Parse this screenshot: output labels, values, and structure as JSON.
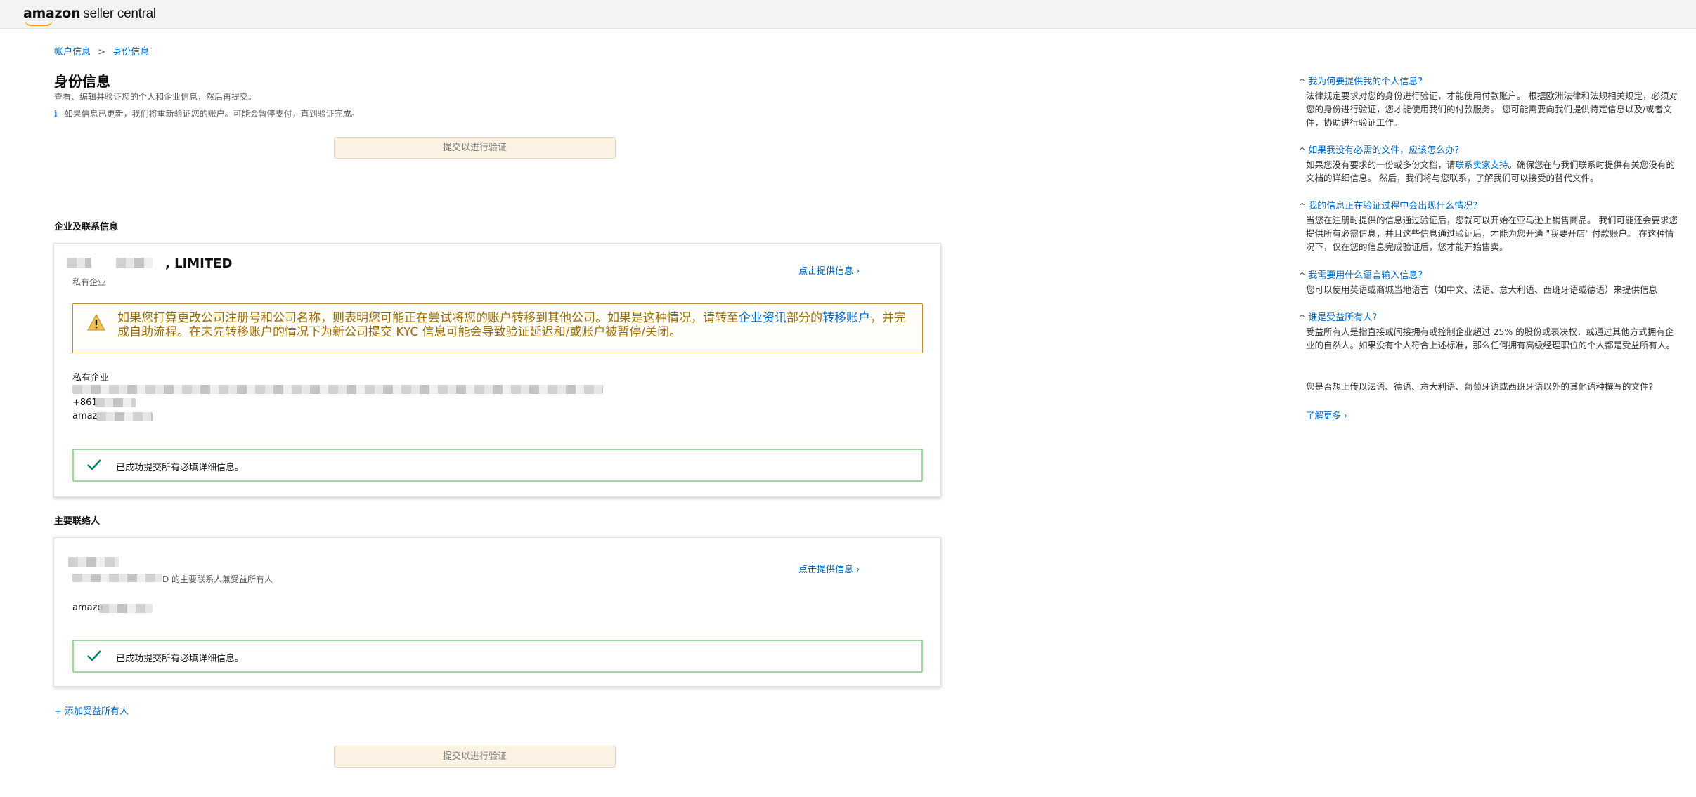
{
  "header": {
    "logo_amazon": "amazon",
    "logo_rest": "seller central"
  },
  "breadcrumb": {
    "parent": "帐户信息",
    "separator": ">",
    "current": "身份信息"
  },
  "page": {
    "title": "身份信息",
    "subtitle": "查看、编辑并验证您的个人和企业信息，然后再提交。",
    "info_icon": "i",
    "info_text": "如果信息已更新，我们将重新验证您的账户。可能会暂停支付，直到验证完成。",
    "submit_label": "提交以进行验证"
  },
  "business_section": {
    "heading": "企业及联系信息",
    "company_name_suffix": ", LIMITED",
    "company_type": "私有企业",
    "provide_link": "点击提供信息 ›",
    "warning": {
      "text_1": "如果您打算更改公司注册号和公司名称，则表明您可能正在尝试将您的账户转移到其他公司。如果是这种情况，请转至",
      "link_1": "企业资讯",
      "text_2": "部分的",
      "link_2": "转移账户",
      "text_3": "，并完成自助流程。在未先转移账户的情况下为新公司提交 KYC 信息可能会导致验证延迟和/或账户被暂停/关闭。"
    },
    "detail_type": "私有企业",
    "detail_phone_prefix": "+861",
    "detail_email_prefix": "amaz",
    "success_message": "已成功提交所有必填详细信息。"
  },
  "contact_section": {
    "heading": "主要联络人",
    "role_text": "D 的主要联系人兼受益所有人",
    "provide_link": "点击提供信息 ›",
    "email_prefix": "amazo",
    "success_message": "已成功提交所有必填详细信息。"
  },
  "add_owner_link": "+ 添加受益所有人",
  "colors": {
    "link": "#0066c0",
    "warning_border": "#b8912e",
    "warning_text": "#9a6d00",
    "success_border": "#9fd99b",
    "check": "#067d62",
    "submit_bg": "#fbf2e3"
  },
  "faq": [
    {
      "question": "我为何要提供我的个人信息?",
      "answer": "法律规定要求对您的身份进行验证，才能使用付款账户。 根据欧洲法律和法规相关规定，必须对您的身份进行验证，您才能使用我们的付款服务。 您可能需要向我们提供特定信息以及/或者文件，协助进行验证工作。"
    },
    {
      "question": "如果我没有必需的文件，应该怎么办?",
      "answer_1": "如果您没有要求的一份或多份文档，请",
      "answer_link": "联系卖家支持",
      "answer_2": "。确保您在与我们联系时提供有关您没有的文档的详细信息。 然后，我们将与您联系，了解我们可以接受的替代文件。"
    },
    {
      "question": "我的信息正在验证过程中会出现什么情况?",
      "answer": "当您在注册时提供的信息通过验证后，您就可以开始在亚马逊上销售商品。 我们可能还会要求您提供所有必需信息，并且这些信息通过验证后，才能为您开通 \"我要开店\" 付款账户。 在这种情况下，仅在您的信息完成验证后，您才能开始售卖。"
    },
    {
      "question": "我需要用什么语言输入信息?",
      "answer": "您可以使用英语或商城当地语言（如中文、法语、意大利语、西班牙语或德语）来提供信息"
    },
    {
      "question": "谁是受益所有人?",
      "answer": "受益所有人是指直接或间接拥有或控制企业超过 25% 的股份或表决权，或通过其他方式拥有企业的自然人。如果没有个人符合上述标准，那么任何拥有高级经理职位的个人都是受益所有人。",
      "extra": "您是否想上传以法语、德语、意大利语、葡萄牙语或西班牙语以外的其他语种撰写的文件?",
      "learn_more": "了解更多 ›"
    }
  ]
}
